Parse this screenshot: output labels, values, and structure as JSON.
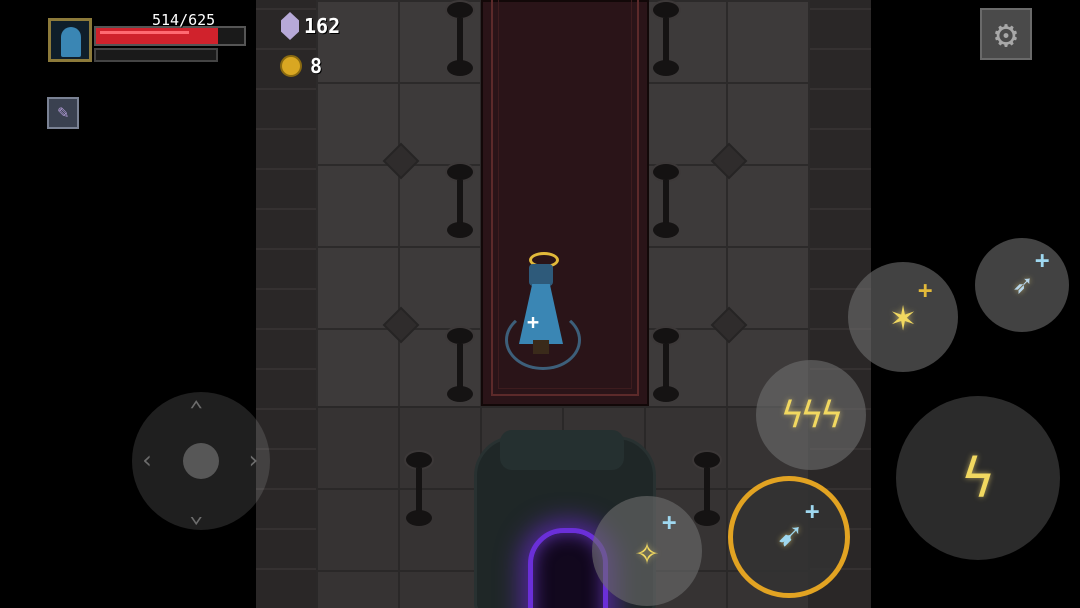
{
  "hud": {
    "hp_text": "514/625",
    "hp_fraction": 0.822,
    "gems": "162",
    "coins": "8"
  },
  "icons": {
    "settings": "gear-icon",
    "gem": "gem-icon",
    "coin": "coin-icon",
    "relic": "relic-icon"
  },
  "colors": {
    "hp": "#d0222c",
    "portal": "#6a2fd8",
    "ring": "#e2a322"
  },
  "skills": [
    {
      "name": "fire-dash",
      "glyph": "✶",
      "plus": "+",
      "plus_color": "#e2b93a"
    },
    {
      "name": "ice-dash",
      "glyph": "➶",
      "plus": "+",
      "plus_color": "#9fd8f0"
    },
    {
      "name": "lightning-storm",
      "glyph": "ϟϟϟ",
      "plus": ""
    },
    {
      "name": "constellation",
      "glyph": "✧",
      "plus": "+",
      "plus_color": "#9fd8f0"
    },
    {
      "name": "ice-slash",
      "glyph": "➹",
      "plus": "+",
      "plus_color": "#9fd8f0"
    },
    {
      "name": "lightning-bolt",
      "glyph": "ϟ",
      "plus": ""
    }
  ]
}
